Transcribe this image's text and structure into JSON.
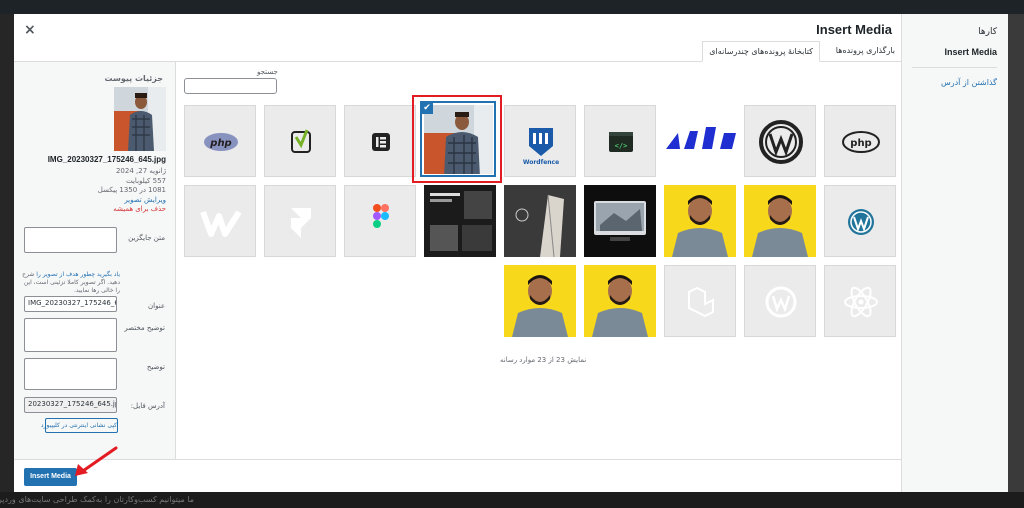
{
  "modal": {
    "title": "Insert Media",
    "close_glyph": "×"
  },
  "menu": {
    "heading": "کارها",
    "insert_media": "Insert Media",
    "insert_from_url": "گذاشتن از آدرس"
  },
  "tabs": [
    {
      "label": "بارگذاری پرونده‌ها",
      "active": false
    },
    {
      "label": "کتابخانهٔ پرونده‌های چندرسانه‌ای",
      "active": true
    }
  ],
  "search": {
    "label": "جستجو",
    "value": ""
  },
  "details": {
    "heading": "جزئیات پیوست",
    "filename": "IMG_20230327_175246_645.jpg",
    "date": "ژانویه 27, 2024",
    "size": "557 کیلوبایت",
    "dimensions": "1081 در 1350 پیکسل",
    "edit_link": "ویرایش تصویر",
    "delete_link": "حذف برای همیشه",
    "alt_label": "متن جایگزین",
    "alt_value": "",
    "help_link": "یاد بگیرید چطور هدف از تصویر را",
    "help_text": "شرح دهید. اگر تصویر کاملا تزئینی است، این را خالی رها نمایید.",
    "title_label": "عنوان",
    "title_value": "IMG_20230327_175246_645",
    "caption_label": "توضیح مختصر",
    "caption_value": "",
    "description_label": "توضیح",
    "description_value": "",
    "url_label": "آدرس فایل:",
    "url_value": "20230327_175246_645.jpg",
    "copy_button": "کپی نشانی اینترنتی در کلیپبورد"
  },
  "grid": {
    "tiles": [
      {
        "kind": "php-oval",
        "style": "gray"
      },
      {
        "kind": "yoast",
        "style": "gray"
      },
      {
        "kind": "elementor",
        "style": "gray"
      },
      {
        "kind": "photo-selected",
        "style": "white",
        "selected": true
      },
      {
        "kind": "wordfence",
        "style": "gray"
      },
      {
        "kind": "code",
        "style": "gray"
      },
      {
        "kind": "blue-text",
        "style": "white"
      },
      {
        "kind": "wordpress-black",
        "style": "gray"
      },
      {
        "kind": "php-bold",
        "style": "gray"
      },
      {
        "kind": "webflow",
        "style": "gray"
      },
      {
        "kind": "framer",
        "style": "gray"
      },
      {
        "kind": "figma",
        "style": "gray"
      },
      {
        "kind": "dark-site",
        "style": "dark"
      },
      {
        "kind": "dark-arch",
        "style": "dark"
      },
      {
        "kind": "laptop",
        "style": "dark"
      },
      {
        "kind": "person-yellow",
        "style": "yellow"
      },
      {
        "kind": "person-yellow",
        "style": "yellow"
      },
      {
        "kind": "wordpress-blue",
        "style": "gray"
      },
      {
        "kind": "person-yellow",
        "style": "yellow"
      },
      {
        "kind": "person-yellow",
        "style": "yellow"
      },
      {
        "kind": "laravel",
        "style": "gray"
      },
      {
        "kind": "wordpress-gray",
        "style": "gray"
      },
      {
        "kind": "react",
        "style": "gray"
      }
    ],
    "count_text": "نمایش 23 از 23 موارد رسانه"
  },
  "footer": {
    "insert_button": "Insert Media"
  },
  "backdrop": {
    "bottom_text": "ما میتوانیم کسب‌وکارتان را به‌کمک طراحی سایت‌های وردپرسی و بهینه‌سازی برای موتورهای جستجو رشد دهیم"
  },
  "colors": {
    "accent": "#2271b1",
    "highlight": "#e31b23",
    "danger": "#d63638"
  }
}
